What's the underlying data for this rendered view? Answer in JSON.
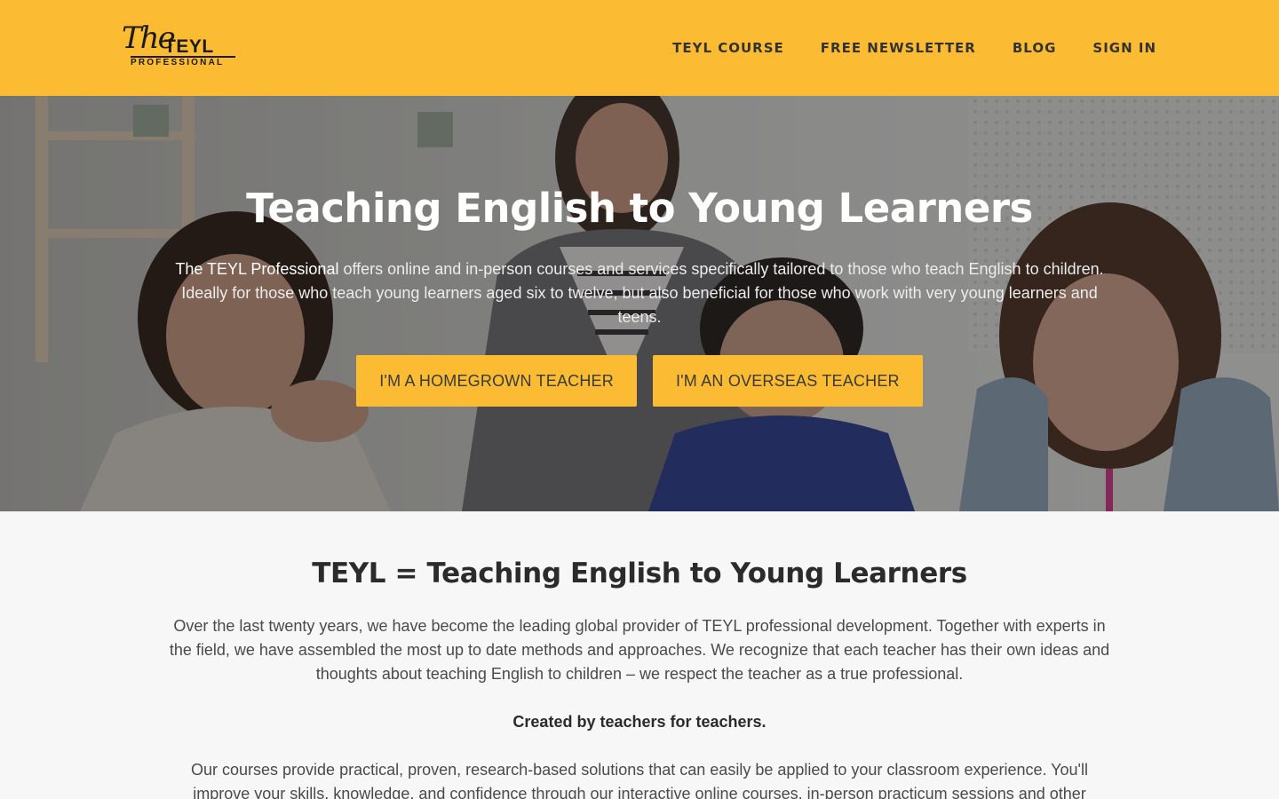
{
  "colors": {
    "accent": "#fbbc33",
    "heading_dark": "#2b2b2b",
    "body_text": "#4a4a4a",
    "hero_text": "#ffffff"
  },
  "logo": {
    "script": "The",
    "brand": "TEYL",
    "subtitle": "PROFESSIONAL"
  },
  "nav": {
    "items": [
      {
        "label": "TEYL COURSE"
      },
      {
        "label": "FREE NEWSLETTER"
      },
      {
        "label": "BLOG"
      },
      {
        "label": "SIGN IN"
      }
    ]
  },
  "hero": {
    "title": "Teaching English to Young Learners",
    "brand_name": "The TEYL Professional",
    "description": " offers online and in-person courses and services specifically tailored to those who teach English to children. Ideally for those who teach young learners aged six to twelve, but also beneficial for those who work with very young learners and teens.",
    "buttons": [
      {
        "label": "I'M A HOMEGROWN TEACHER"
      },
      {
        "label": "I'M AN OVERSEAS TEACHER"
      }
    ]
  },
  "about": {
    "title": "TEYL = Teaching English to Young Learners",
    "paragraph1": "Over the last twenty years, we have become the leading global provider of TEYL professional development. Together with experts in the field, we have assembled the most up to date methods and approaches. We recognize that each teacher has their own ideas and thoughts about teaching English to children – we respect the teacher as a true professional.",
    "tagline": "Created by teachers for teachers.",
    "paragraph2": "Our courses provide practical, proven, research-based solutions that can easily be applied to your classroom experience. You'll improve your skills, knowledge, and confidence through our interactive online courses, in-person practicum sessions and other"
  }
}
